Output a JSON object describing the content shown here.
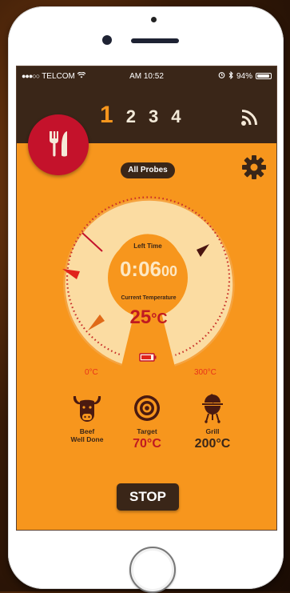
{
  "status": {
    "carrier": "TELCOM",
    "time": "AM 10:52",
    "battery": "94%",
    "battery_level": 0.94
  },
  "tabs": [
    {
      "label": "1",
      "active": true
    },
    {
      "label": "2",
      "active": false
    },
    {
      "label": "3",
      "active": false
    },
    {
      "label": "4",
      "active": false
    }
  ],
  "probes_button": "All Probes",
  "gauge": {
    "left_time_label": "Left Time",
    "timer_main": "0:06",
    "timer_sec": "00",
    "current_temp_label": "Current Temperature",
    "current_temp_value": "25",
    "current_temp_unit": "°C",
    "scale_min": "0°C",
    "scale_max": "300°C"
  },
  "info": {
    "meat_line1": "Beef",
    "meat_line2": "Well Done",
    "target_label": "Target",
    "target_value": "70°C",
    "grill_label": "Grill",
    "grill_value": "200°C"
  },
  "stop_button": "STOP",
  "icons": {
    "logo": "fork-knife-icon",
    "signal": "signal-icon",
    "settings": "gear-icon",
    "battery": "battery-low-icon",
    "meat": "cow-icon",
    "target": "target-icon",
    "grill": "grill-icon"
  },
  "colors": {
    "background": "#f7961d",
    "header": "#3a2618",
    "accent_red": "#c4122b",
    "temp_red": "#c01a21",
    "dial_fill": "#fbdca2"
  }
}
